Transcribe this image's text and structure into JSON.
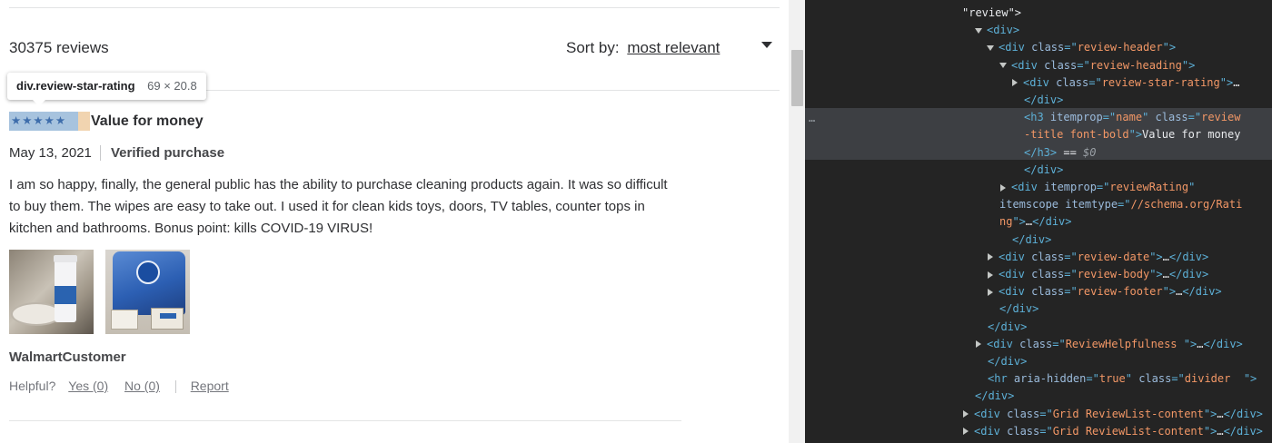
{
  "page": {
    "reviews_count": "30375 reviews",
    "sort_label": "Sort by:",
    "sort_value": "most relevant",
    "tooltip": {
      "selector": "div.review-star-rating",
      "size": "69 × 20.8"
    },
    "review": {
      "rating_stars": 5,
      "stars_glyphs": "★★★★★",
      "title": "Value for money",
      "date": "May 13, 2021",
      "verified": "Verified purchase",
      "body": "I am so happy, finally, the general public has the ability to purchase cleaning products again. It was so difficult to buy them. The wipes are easy to take out. I used it for clean kids toys, doors, TV tables, counter tops in kitchen and bathrooms. Bonus point: kills COVID-19 VIRUS!",
      "photos": [
        "photo-wipes-canister",
        "photo-wipes-bag"
      ],
      "author": "WalmartCustomer",
      "helpful_label": "Helpful?",
      "yes_label": "Yes (0)",
      "no_label": "No (0)",
      "report_label": "Report"
    }
  },
  "devtools": {
    "lines": [
      {
        "indent": 0,
        "tri": "none",
        "tokens": [
          [
            "tx",
            "\"review\">"
          ]
        ]
      },
      {
        "indent": 1,
        "tri": "down",
        "tokens": [
          [
            "tg",
            "<div>"
          ]
        ]
      },
      {
        "indent": 2,
        "tri": "down",
        "tokens": [
          [
            "tg",
            "<div "
          ],
          [
            "an",
            "class"
          ],
          [
            "tg",
            "=\""
          ],
          [
            "av",
            "review-header"
          ],
          [
            "tg",
            "\">"
          ]
        ]
      },
      {
        "indent": 3,
        "tri": "down",
        "tokens": [
          [
            "tg",
            "<div "
          ],
          [
            "an",
            "class"
          ],
          [
            "tg",
            "=\""
          ],
          [
            "av",
            "review-heading"
          ],
          [
            "tg",
            "\">"
          ]
        ]
      },
      {
        "indent": 4,
        "tri": "right",
        "tokens": [
          [
            "tg",
            "<div "
          ],
          [
            "an",
            "class"
          ],
          [
            "tg",
            "=\""
          ],
          [
            "av",
            "review-star-rating"
          ],
          [
            "tg",
            "\">"
          ],
          [
            "tx",
            "…"
          ]
        ]
      },
      {
        "indent": 4,
        "tri": "none",
        "tokens": [
          [
            "tg",
            "</div>"
          ]
        ]
      },
      {
        "indent": 5,
        "tri": "none",
        "tokens": [
          [
            "tg",
            "<h3 "
          ],
          [
            "an",
            "itemprop"
          ],
          [
            "tg",
            "=\""
          ],
          [
            "av",
            "name"
          ],
          [
            "tg",
            "\" "
          ],
          [
            "an",
            "class"
          ],
          [
            "tg",
            "=\""
          ],
          [
            "av",
            "review"
          ]
        ]
      },
      {
        "indent": 5,
        "tri": "none",
        "tokens": [
          [
            "av",
            "-title font-bold"
          ],
          [
            "tg",
            "\">"
          ],
          [
            "tx",
            "Value for money"
          ]
        ]
      },
      {
        "indent": 5,
        "tri": "none",
        "tokens": [
          [
            "tg",
            "</h3>"
          ],
          [
            "tx",
            " == "
          ],
          [
            "dm",
            "$0"
          ]
        ]
      },
      {
        "indent": 4,
        "tri": "none",
        "tokens": [
          [
            "tg",
            "</div>"
          ]
        ]
      },
      {
        "indent": 3,
        "tri": "right",
        "tokens": [
          [
            "tg",
            "<div "
          ],
          [
            "an",
            "itemprop"
          ],
          [
            "tg",
            "=\""
          ],
          [
            "av",
            "reviewRating"
          ],
          [
            "tg",
            "\""
          ]
        ]
      },
      {
        "indent": 3,
        "tri": "none",
        "tokens": [
          [
            "an",
            "itemscope itemtype"
          ],
          [
            "tg",
            "=\""
          ],
          [
            "av",
            "//schema.org/Rati"
          ]
        ]
      },
      {
        "indent": 3,
        "tri": "none",
        "tokens": [
          [
            "av",
            "ng"
          ],
          [
            "tg",
            "\">"
          ],
          [
            "tx",
            "…"
          ],
          [
            "tg",
            "</div>"
          ]
        ]
      },
      {
        "indent": 3,
        "tri": "none",
        "tokens": [
          [
            "tg",
            "</div>"
          ]
        ]
      },
      {
        "indent": 2,
        "tri": "right",
        "tokens": [
          [
            "tg",
            "<div "
          ],
          [
            "an",
            "class"
          ],
          [
            "tg",
            "=\""
          ],
          [
            "av",
            "review-date"
          ],
          [
            "tg",
            "\">"
          ],
          [
            "tx",
            "…"
          ],
          [
            "tg",
            "</div>"
          ]
        ]
      },
      {
        "indent": 2,
        "tri": "right",
        "tokens": [
          [
            "tg",
            "<div "
          ],
          [
            "an",
            "class"
          ],
          [
            "tg",
            "=\""
          ],
          [
            "av",
            "review-body"
          ],
          [
            "tg",
            "\">"
          ],
          [
            "tx",
            "…"
          ],
          [
            "tg",
            "</div>"
          ]
        ]
      },
      {
        "indent": 2,
        "tri": "right",
        "tokens": [
          [
            "tg",
            "<div "
          ],
          [
            "an",
            "class"
          ],
          [
            "tg",
            "=\""
          ],
          [
            "av",
            "review-footer"
          ],
          [
            "tg",
            "\">"
          ],
          [
            "tx",
            "…"
          ],
          [
            "tg",
            "</div>"
          ]
        ]
      },
      {
        "indent": 2,
        "tri": "none",
        "tokens": [
          [
            "tg",
            "</div>"
          ]
        ]
      },
      {
        "indent": 1,
        "tri": "none",
        "tokens": [
          [
            "tg",
            "</div>"
          ]
        ]
      },
      {
        "indent": 1,
        "tri": "right",
        "tokens": [
          [
            "tg",
            "<div "
          ],
          [
            "an",
            "class"
          ],
          [
            "tg",
            "=\""
          ],
          [
            "av",
            "ReviewHelpfulness "
          ],
          [
            "tg",
            "\">"
          ],
          [
            "tx",
            "…"
          ],
          [
            "tg",
            "</div>"
          ]
        ]
      },
      {
        "indent": 1,
        "tri": "none",
        "tokens": [
          [
            "tg",
            "</div>"
          ]
        ]
      },
      {
        "indent": 1,
        "tri": "none",
        "tokens": [
          [
            "tg",
            "<hr "
          ],
          [
            "an",
            "aria-hidden"
          ],
          [
            "tg",
            "=\""
          ],
          [
            "av",
            "true"
          ],
          [
            "tg",
            "\" "
          ],
          [
            "an",
            "class"
          ],
          [
            "tg",
            "=\""
          ],
          [
            "av",
            "divider  "
          ],
          [
            "tg",
            "\">"
          ]
        ]
      },
      {
        "indent": 0,
        "tri": "none",
        "tokens": [
          [
            "tg",
            "</div>"
          ]
        ]
      },
      {
        "indent": 0,
        "tri": "right",
        "tokens": [
          [
            "tg",
            "<div "
          ],
          [
            "an",
            "class"
          ],
          [
            "tg",
            "=\""
          ],
          [
            "av",
            "Grid ReviewList-content"
          ],
          [
            "tg",
            "\">"
          ],
          [
            "tx",
            "…"
          ],
          [
            "tg",
            "</div>"
          ]
        ]
      },
      {
        "indent": 0,
        "tri": "right",
        "tokens": [
          [
            "tg",
            "<div "
          ],
          [
            "an",
            "class"
          ],
          [
            "tg",
            "=\""
          ],
          [
            "av",
            "Grid ReviewList-content"
          ],
          [
            "tg",
            "\">"
          ],
          [
            "tx",
            "…"
          ],
          [
            "tg",
            "</div>"
          ]
        ]
      }
    ]
  },
  "colors": {
    "star_blue": "#3e6dab",
    "highlight_content": "#a7c3de",
    "highlight_margin": "#f1d4b0",
    "devtools_bg": "#242424",
    "devtools_selected": "#3d3f43"
  }
}
